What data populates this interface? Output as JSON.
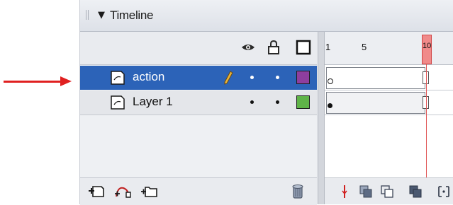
{
  "panel": {
    "title": "Timeline",
    "collapse_icon": "▼"
  },
  "header_icons": [
    "eye-icon",
    "lock-icon",
    "outline-icon"
  ],
  "layers": [
    {
      "name": "action",
      "selected": true,
      "editing": true,
      "color": "#8e3e9e",
      "keyframe": "empty"
    },
    {
      "name": "Layer 1",
      "selected": false,
      "editing": false,
      "color": "#5fb448",
      "keyframe": "filled"
    }
  ],
  "ruler": {
    "labels": [
      "1",
      "5",
      "10"
    ],
    "current_frame": 10
  },
  "colors": {
    "selection": "#2c63b8",
    "playhead": "#e05555",
    "annotation_arrow": "#e02020"
  },
  "toolbar_icons": [
    "insert-layer-icon",
    "add-motion-guide-icon",
    "insert-folder-icon",
    "delete-layer-icon"
  ],
  "frame_toolbar_icons": [
    "center-frame-icon",
    "onion-skin-icon",
    "onion-outline-icon",
    "edit-multiple-frames-icon",
    "modify-onion-markers-icon"
  ]
}
